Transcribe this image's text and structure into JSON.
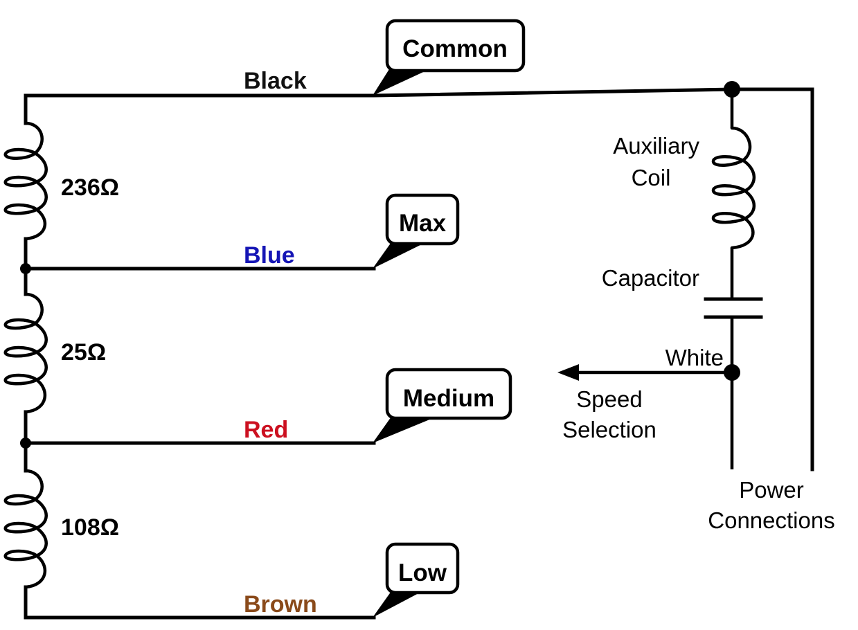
{
  "diagram": {
    "type": "three-speed PSC motor wiring diagram",
    "main_winding": {
      "resistances": [
        {
          "label": "236Ω",
          "between": [
            "Black",
            "Blue"
          ]
        },
        {
          "label": "25Ω",
          "between": [
            "Blue",
            "Red"
          ]
        },
        {
          "label": "108Ω",
          "between": [
            "Red",
            "Brown"
          ]
        }
      ]
    },
    "wires": [
      {
        "id": "black",
        "label": "Black",
        "color": "#111111",
        "callout": "Common"
      },
      {
        "id": "blue",
        "label": "Blue",
        "color": "#1515b5",
        "callout": "Max"
      },
      {
        "id": "red",
        "label": "Red",
        "color": "#cc1020",
        "callout": "Medium"
      },
      {
        "id": "brown",
        "label": "Brown",
        "color": "#8a4a1a",
        "callout": "Low"
      }
    ],
    "auxiliary": {
      "coil_label_line1": "Auxiliary",
      "coil_label_line2": "Coil",
      "capacitor_label": "Capacitor",
      "white_label": "White"
    },
    "speed_selection": {
      "line1": "Speed",
      "line2": "Selection"
    },
    "power": {
      "line1": "Power",
      "line2": "Connections"
    }
  }
}
